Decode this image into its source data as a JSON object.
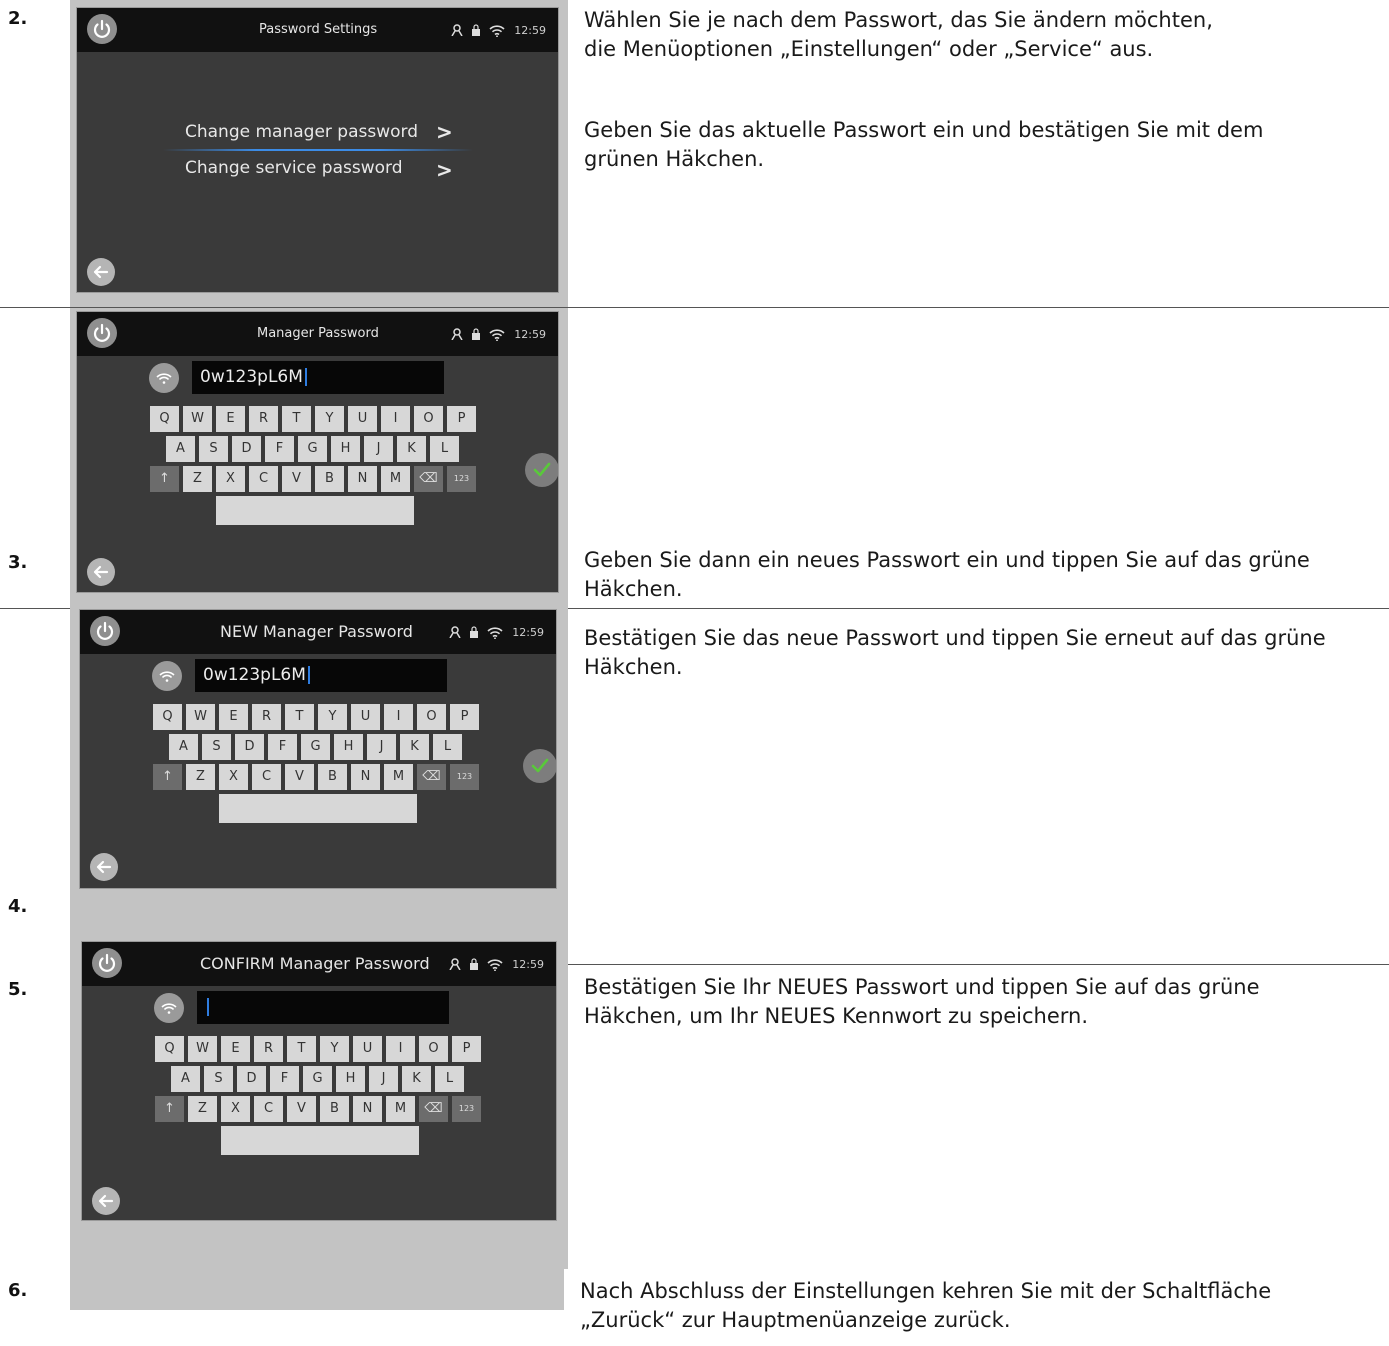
{
  "steps": [
    {
      "number": "2.",
      "description_lines": [
        "Wählen Sie je nach dem Passwort, das Sie ändern möchten,",
        "die Menüoptionen „Einstellungen“ oder „Service“ aus."
      ],
      "extra_lines": [
        "Geben Sie das aktuelle Passwort ein und bestätigen Sie mit dem",
        "grünen Häkchen."
      ]
    },
    {
      "number": "3.",
      "description_lines": [
        "Geben Sie dann ein neues Passwort ein und tippen Sie auf das grüne",
        "Häkchen."
      ]
    },
    {
      "number": "4.",
      "description_lines": [
        "Bestätigen Sie das neue Passwort und tippen Sie erneut auf das grüne",
        "Häkchen."
      ]
    },
    {
      "number": "5.",
      "description_lines": [
        "Bestätigen Sie Ihr NEUES Passwort und tippen Sie auf das grüne",
        "Häkchen, um Ihr NEUES Kennwort zu speichern."
      ]
    },
    {
      "number": "6.",
      "description_lines": [
        "Nach Abschluss der Einstellungen kehren Sie mit der Schaltfläche",
        "„Zurück“ zur Hauptmenüanzeige zurück."
      ]
    }
  ],
  "screens": {
    "settings": {
      "title": "Password Settings",
      "time": "12:59",
      "menu": [
        "Change manager password",
        "Change service password"
      ],
      "chevron": ">"
    },
    "manager": {
      "title": "Manager Password",
      "time": "12:59",
      "field_value": "0w123pL6M"
    },
    "new_manager": {
      "title": "NEW Manager Password",
      "time": "12:59",
      "field_value": "0w123pL6M"
    },
    "confirm_manager": {
      "title": "CONFIRM Manager Password",
      "time": "12:59",
      "field_value": ""
    }
  },
  "keyboard": {
    "row1": [
      "Q",
      "W",
      "E",
      "R",
      "T",
      "Y",
      "U",
      "I",
      "O",
      "P"
    ],
    "row2": [
      "A",
      "S",
      "D",
      "F",
      "G",
      "H",
      "J",
      "K",
      "L"
    ],
    "row3": [
      "↑",
      "Z",
      "X",
      "C",
      "V",
      "B",
      "N",
      "M",
      "⌫",
      "123"
    ]
  },
  "colors": {
    "check_green": "#59c93a",
    "field_caret": "#2f7de0",
    "screen_bg": "#3a3a3a"
  },
  "icons": [
    "power-icon",
    "user-icon",
    "lock-icon",
    "wifi-icon",
    "back-arrow-icon",
    "checkmark-icon"
  ]
}
